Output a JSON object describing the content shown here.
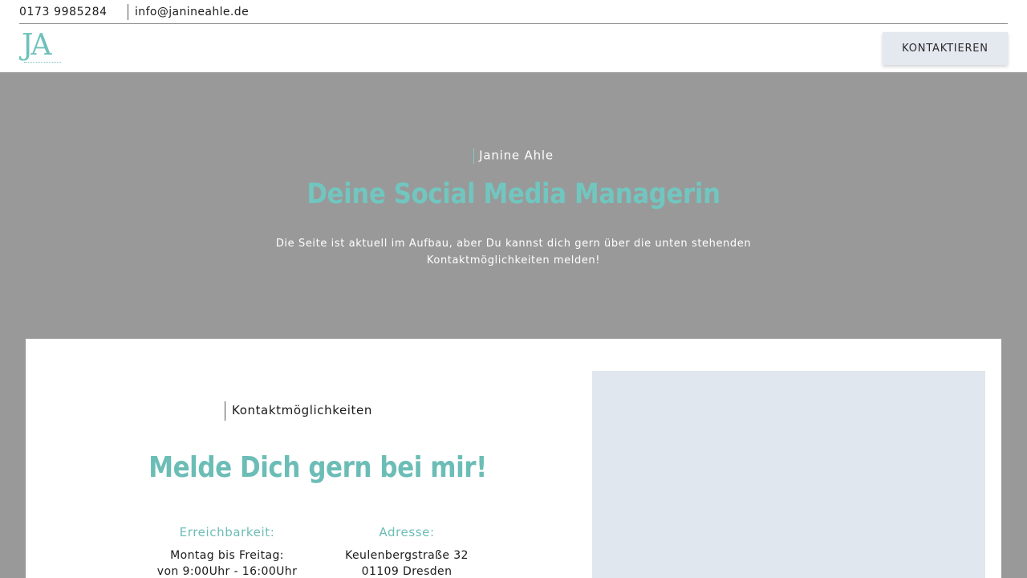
{
  "topbar": {
    "phone": "0173 9985284",
    "email": "info@janineahle.de"
  },
  "header": {
    "logo_text": "JA",
    "cta_label": "KONTAKTIEREN"
  },
  "hero": {
    "kicker": "Janine Ahle",
    "headline": "Deine Social Media Managerin",
    "intro": "Die Seite ist aktuell im Aufbau, aber Du kannst dich gern über die unten stehenden Kontaktmöglichkeiten melden!"
  },
  "contact": {
    "kicker": "Kontaktmöglichkeiten",
    "title": "Melde Dich gern bei mir!",
    "availability": {
      "heading": "Erreichbarkeit:",
      "line1": "Montag bis Freitag:",
      "line2": "von 9:00Uhr - 16:00Uhr"
    },
    "address": {
      "heading": "Adresse:",
      "line1": "Keulenbergstraße 32",
      "line2": "01109 Dresden"
    }
  },
  "colors": {
    "accent": "#6ec1bb",
    "hero_bg": "#999999",
    "button_bg": "#e4e8ef",
    "map_bg": "#e1e7ef"
  }
}
